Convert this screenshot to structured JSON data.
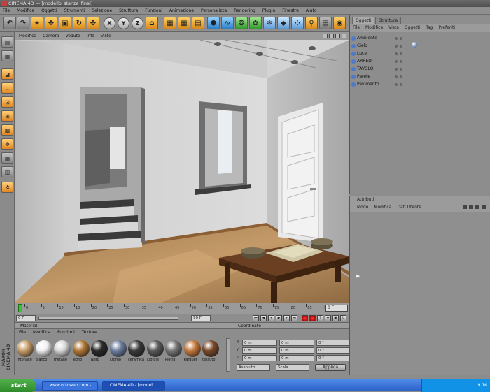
{
  "window": {
    "title": "CINEMA 4D — [modello_stanza_final]"
  },
  "menu": [
    "File",
    "Modifica",
    "Oggetti",
    "Strumenti",
    "Selezione",
    "Struttura",
    "Funzioni",
    "Animazione",
    "Personalizza",
    "Rendering",
    "Plugin",
    "Finestre",
    "Aiuto"
  ],
  "viewport_menu": [
    "Modifica",
    "Camera",
    "Vedute",
    "Info",
    "Viste"
  ],
  "toolbar": {
    "undo": "↶",
    "redo": "↷",
    "x": "X",
    "y": "Y",
    "z": "Z"
  },
  "timeline": {
    "ticks": [
      "0",
      "5",
      "10",
      "15",
      "20",
      "25",
      "30",
      "35",
      "40",
      "45",
      "50",
      "55",
      "60",
      "65",
      "70",
      "75",
      "80",
      "85",
      "90"
    ],
    "frame_field": "0 F"
  },
  "playbar": {
    "start": "0 F",
    "end": "90 F"
  },
  "materials_panel": {
    "header": "Materiali",
    "menu": [
      "File",
      "Modifica",
      "Funzioni",
      "Texture"
    ],
    "materials": [
      {
        "label": "Intonaco",
        "color": "#c9a06a"
      },
      {
        "label": "Bianco",
        "color": "#f0f0f0"
      },
      {
        "label": "metallo",
        "color": "#d8d8d8"
      },
      {
        "label": "legno",
        "color": "#b07838"
      },
      {
        "label": "Nero",
        "color": "#2a2a2a"
      },
      {
        "label": "Cromo",
        "color": "#6f7fa0"
      },
      {
        "label": "ceramica",
        "color": "#3a3a3a"
      },
      {
        "label": "Ciotole",
        "color": "#5a5a5a"
      },
      {
        "label": "Pietra",
        "color": "#777777"
      },
      {
        "label": "Parquet",
        "color": "#c77a3e"
      },
      {
        "label": "tessuto",
        "color": "#7a4a2a"
      }
    ]
  },
  "coordinates_panel": {
    "header": "Coordinate",
    "rows": [
      {
        "axis": "X",
        "pos": "0 m",
        "size": "0 m",
        "rot": "0 °"
      },
      {
        "axis": "Y",
        "pos": "0 m",
        "size": "0 m",
        "rot": "0 °"
      },
      {
        "axis": "Z",
        "pos": "0 m",
        "size": "0 m",
        "rot": "0 °"
      }
    ],
    "mode_left": "Assoluto",
    "mode_right": "Scala",
    "apply": "Applica"
  },
  "right_tabs": [
    "Oggetti",
    "Struttura"
  ],
  "object_menu": [
    "File",
    "Modifica",
    "Vista",
    "Oggetti",
    "Tag",
    "Preferiti"
  ],
  "objects": [
    {
      "name": "Ambiente"
    },
    {
      "name": "Cielo"
    },
    {
      "name": "Luce"
    },
    {
      "name": "ARREDI"
    },
    {
      "name": "TAVOLO"
    },
    {
      "name": "Parete"
    },
    {
      "name": "Pavimento"
    }
  ],
  "attributes": {
    "header": "Attributi",
    "menu": [
      "Modo",
      "Modifica",
      "Dati Utente"
    ]
  },
  "taskbar": {
    "start": "start",
    "tasks": [
      "www.ottoweb.com -",
      "CINEMA 4D - [modell..."
    ],
    "clock": "9.16"
  },
  "brand": "MAXON CINEMA 4D",
  "colors": {
    "accent": "#e59a2c",
    "wall": "#d7d7d7",
    "floor": "#b58a5a"
  }
}
